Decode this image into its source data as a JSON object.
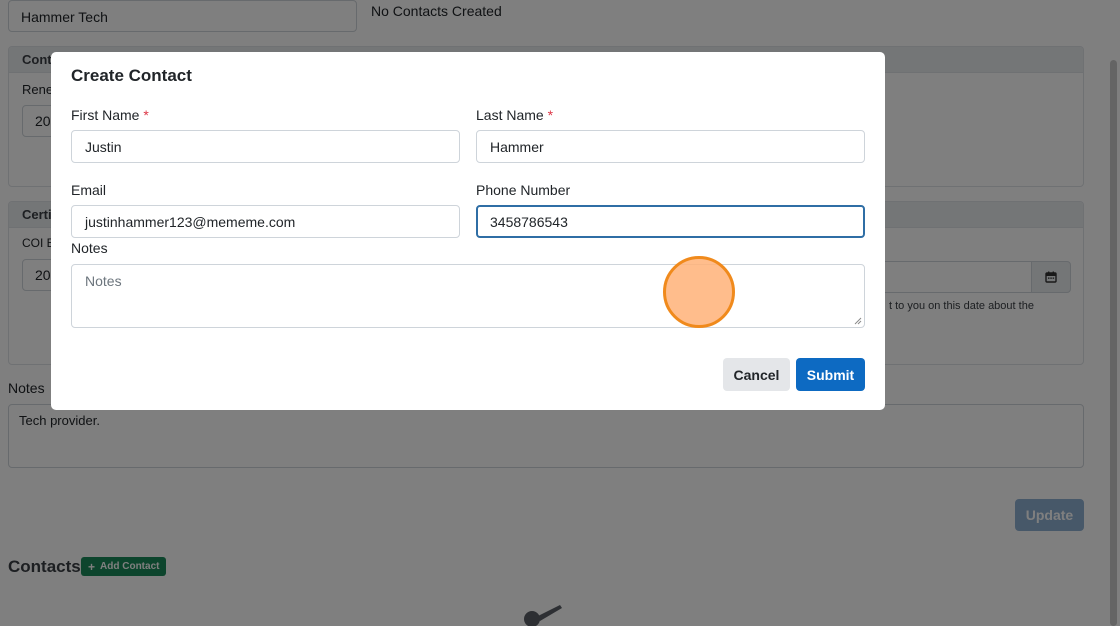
{
  "background": {
    "vendor_name": "Hammer Tech",
    "no_contacts_text": "No Contacts Created",
    "contract_header": "Contr",
    "renewal_label": "Rene",
    "renewal_value": "20",
    "cert_header": "Certi",
    "coi_label": "COI E",
    "coi_value": "20",
    "reminder_text": "t to you on this date about the",
    "notes_label": "Notes",
    "notes_value": "Tech provider.",
    "update_label": "Update",
    "contacts_heading": "Contacts",
    "add_contact_label": "Add Contact"
  },
  "modal": {
    "title": "Create Contact",
    "required_mark": "*",
    "first_name_label": "First Name",
    "first_name_value": "Justin",
    "last_name_label": "Last Name",
    "last_name_value": "Hammer",
    "email_label": "Email",
    "email_value": "justinhammer123@mememe.com",
    "phone_label": "Phone Number",
    "phone_value": "3458786543",
    "notes_label": "Notes",
    "notes_placeholder": "Notes",
    "cancel_label": "Cancel",
    "submit_label": "Submit"
  },
  "colors": {
    "primary": "#0d6ac2",
    "success": "#1a8a5a",
    "required": "#dc3545",
    "click_indicator": "#f08a1c"
  }
}
